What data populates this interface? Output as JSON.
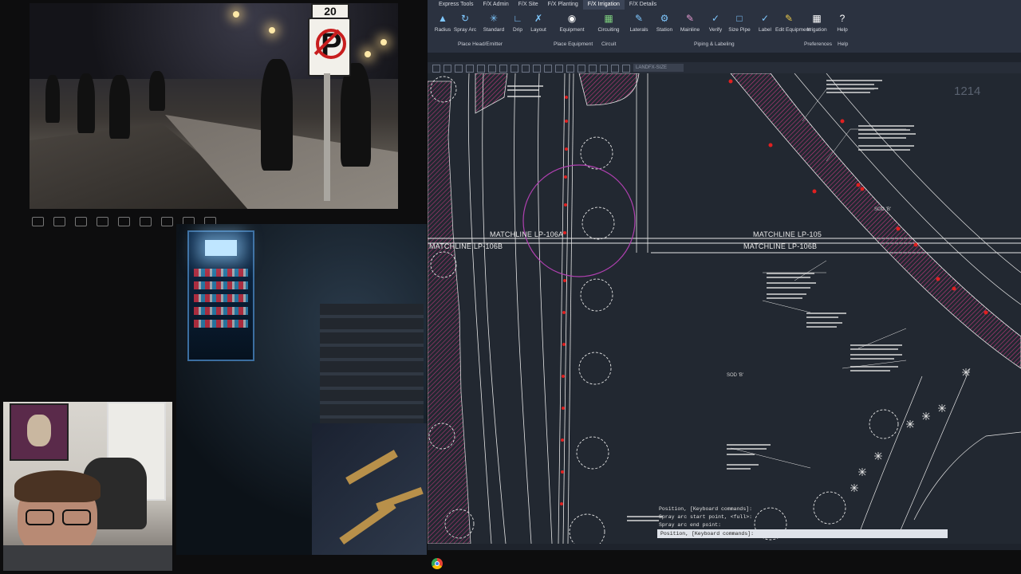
{
  "photo": {
    "sign_number": "20",
    "sign_letter": "P"
  },
  "cad": {
    "ribbon_tabs": [
      "Express Tools",
      "F/X Admin",
      "F/X Site",
      "F/X Planting",
      "F/X Irrigation",
      "F/X Details"
    ],
    "active_tab_index": 4,
    "tools": [
      {
        "label": "Radius",
        "icon": "radius-icon"
      },
      {
        "label": "Spray Arc",
        "icon": "spray-arc-icon"
      },
      {
        "label": "Standard",
        "icon": "sprinkler-icon"
      },
      {
        "label": "Drip",
        "icon": "drip-icon"
      },
      {
        "label": "Layout",
        "icon": "layout-icon"
      },
      {
        "label": "Equipment",
        "icon": "equipment-icon"
      },
      {
        "label": "Circuiting",
        "icon": "circuiting-icon"
      },
      {
        "label": "Laterals",
        "icon": "laterals-icon"
      },
      {
        "label": "Station",
        "icon": "station-icon"
      },
      {
        "label": "Mainline",
        "icon": "mainline-icon"
      },
      {
        "label": "Verify",
        "icon": "verify-icon"
      },
      {
        "label": "Size Pipe",
        "icon": "size-pipe-icon"
      },
      {
        "label": "Label",
        "icon": "label-icon"
      },
      {
        "label": "Edit Equipment",
        "icon": "edit-equipment-icon"
      },
      {
        "label": "Irrigation",
        "icon": "irrigation-icon"
      },
      {
        "label": "Help",
        "icon": "help-icon"
      }
    ],
    "groups": [
      "Place Head/Emitter",
      "Place Equipment",
      "Circuit",
      "Piping & Labeling",
      "Preferences",
      "Help"
    ],
    "layer_field": "LANDFX-SIZE",
    "matchlines": [
      "MATCHLINE LP-106A",
      "MATCHLINE LP-106B",
      "MATCHLINE LP-105",
      "MATCHLINE LP-106B"
    ],
    "sheet_number": "1214",
    "sod_labels": [
      "SOD 'B'",
      "SOD 'B'"
    ],
    "command_history": [
      "Position, [Keyboard commands]:",
      "Spray arc start point, <full>:",
      "Spray arc end point:"
    ],
    "command_prompt": "Position, [Keyboard commands]:"
  },
  "colors": {
    "ribbon_bg": "#2b3240",
    "drawing_bg": "#222831",
    "plant_magenta": "#d23c8c",
    "linework_white": "#e6e6e6"
  }
}
